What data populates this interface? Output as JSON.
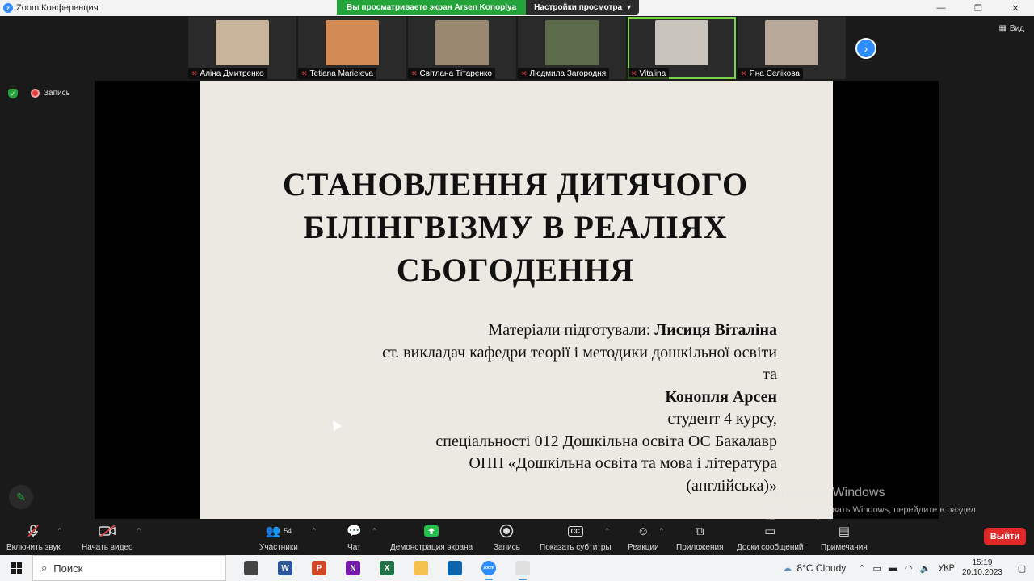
{
  "window": {
    "title": "Zoom Конференция",
    "controls": [
      "—",
      "❐",
      "✕"
    ]
  },
  "share_banner": {
    "viewing_text": "Вы просматриваете экран Arsen Konoplya",
    "view_options": "Настройки просмотра",
    "view_options_caret": "▾"
  },
  "participants": [
    {
      "name": "Аліна Дмитренко",
      "bg": "#c8b49a"
    },
    {
      "name": "Tetiana Marieieva",
      "bg": "#d28b55"
    },
    {
      "name": "Світлана Тітаренко",
      "bg": "#9a8870"
    },
    {
      "name": "Людмила Загородня",
      "bg": "#5c6c4a"
    },
    {
      "name": "Vitalina",
      "bg": "#c9c4bc"
    },
    {
      "name": "Яна Селікова",
      "bg": "#b8a89a"
    }
  ],
  "view_button": "Вид",
  "recording_label": "Запись",
  "slide": {
    "title_lines": [
      "СТАНОВЛЕННЯ ДИТЯЧОГО",
      "БІЛІНГВІЗМУ В РЕАЛІЯХ",
      "СЬОГОДЕННЯ"
    ],
    "prepared_by_label": "Матеріали підготували: ",
    "author1": "Лисиця Віталіна",
    "author1_role": "ст. викладач кафедри теорії і методики дошкільної освіти",
    "and": "та",
    "author2": "Конопля Арсен",
    "author2_role": "студент 4 курсу,",
    "specialty": "спеціальності 012 Дошкільна освіта ОС Бакалавр",
    "program_line1": "ОПП «Дошкільна освіта та мова і література",
    "program_line2": "(англійська)»"
  },
  "activation": {
    "title": "Активация Windows",
    "subtitle": "Чтобы активировать Windows, перейдите в раздел \"Параметры\"."
  },
  "toolbar": {
    "unmute": "Включить звук",
    "start_video": "Начать видео",
    "participants": "Участники",
    "participants_count": "54",
    "chat": "Чат",
    "share_screen": "Демонстрация экрана",
    "record": "Запись",
    "captions": "Показать субтитры",
    "reactions": "Реакции",
    "apps": "Приложения",
    "whiteboards": "Доски сообщений",
    "notes": "Примечания",
    "leave": "Выйти"
  },
  "taskbar": {
    "search_placeholder": "Поиск",
    "apps": [
      {
        "name": "task-view",
        "label": "",
        "color": "#444"
      },
      {
        "name": "word",
        "label": "W",
        "color": "#2b579a"
      },
      {
        "name": "powerpoint",
        "label": "P",
        "color": "#d24726"
      },
      {
        "name": "onenote",
        "label": "N",
        "color": "#7719aa"
      },
      {
        "name": "excel",
        "label": "X",
        "color": "#217346"
      },
      {
        "name": "explorer",
        "label": "",
        "color": "#f2c14e"
      },
      {
        "name": "mail",
        "label": "",
        "color": "#0a64ad"
      },
      {
        "name": "zoom",
        "label": "zoom",
        "color": "#2d8cff"
      },
      {
        "name": "snipping",
        "label": "",
        "color": "#e0e0e0"
      }
    ],
    "weather": "8°C  Cloudy",
    "language": "УКР",
    "time": "15:19",
    "date": "20.10.2023"
  }
}
